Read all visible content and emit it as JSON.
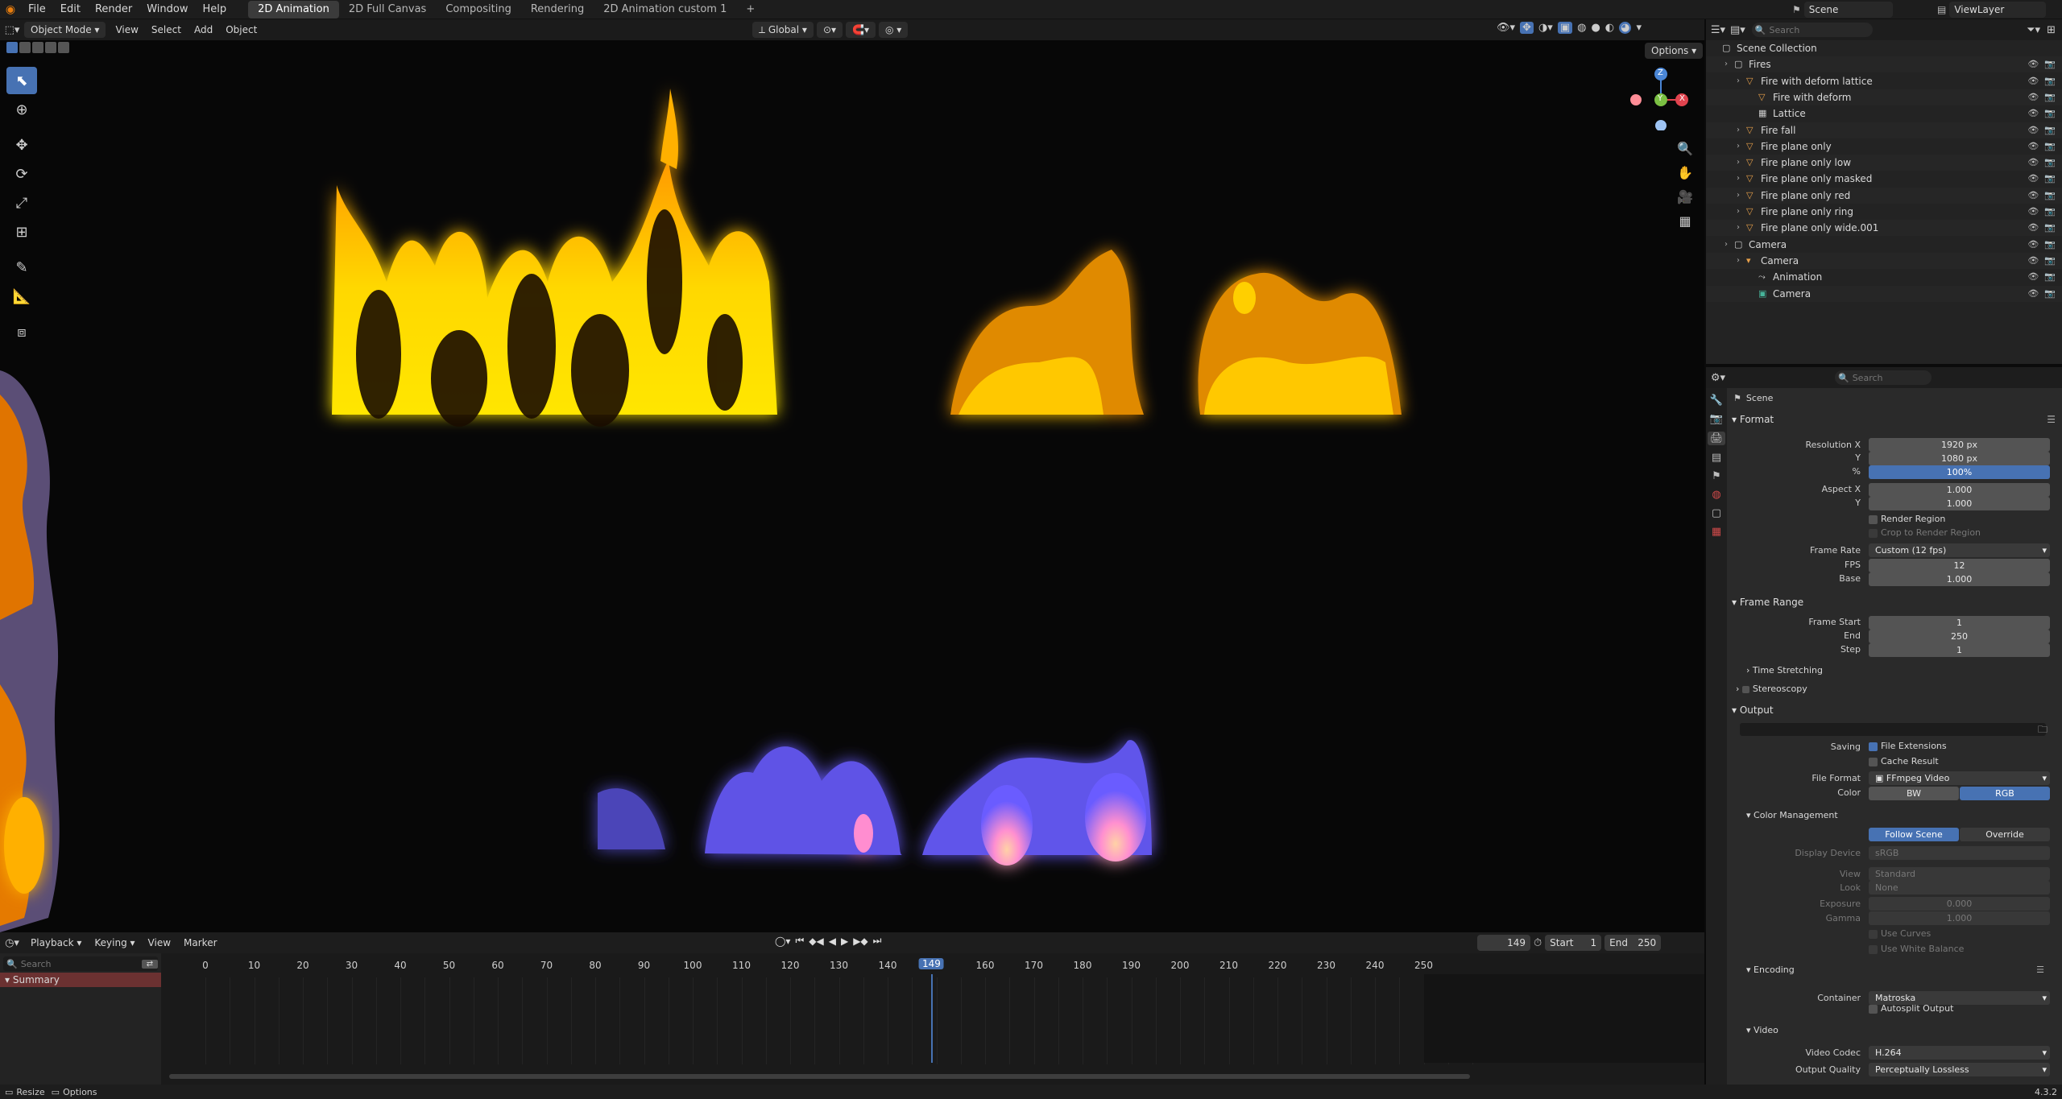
{
  "topbar": {
    "menus": [
      "File",
      "Edit",
      "Render",
      "Window",
      "Help"
    ],
    "workspaces": [
      "2D Animation",
      "2D Full Canvas",
      "Compositing",
      "Rendering",
      "2D Animation custom 1"
    ],
    "add_tab": "+",
    "scene": "Scene",
    "view_layer": "ViewLayer"
  },
  "viewport": {
    "mode": "Object Mode",
    "menus": [
      "View",
      "Select",
      "Add",
      "Object"
    ],
    "transform_orientation": "Global",
    "options": "Options",
    "gizmo": {
      "z": "Z",
      "y": "Y",
      "x": "X"
    }
  },
  "timeline": {
    "menus": [
      "Playback",
      "Keying",
      "View",
      "Marker"
    ],
    "current_frame": "149",
    "start_label": "Start",
    "start": "1",
    "end_label": "End",
    "end": "250",
    "search_placeholder": "Search",
    "summary": "Summary",
    "ticks": [
      "0",
      "10",
      "20",
      "30",
      "40",
      "50",
      "60",
      "70",
      "80",
      "90",
      "100",
      "110",
      "120",
      "130",
      "140",
      "149",
      "160",
      "170",
      "180",
      "190",
      "200",
      "210",
      "220",
      "230",
      "240",
      "250"
    ]
  },
  "statusbar": {
    "resize": "Resize",
    "options": "Options",
    "version": "4.3.2"
  },
  "outliner": {
    "search_placeholder": "Search",
    "rows": [
      {
        "label": "Scene Collection",
        "indent": 0
      },
      {
        "label": "Fires",
        "indent": 1
      },
      {
        "label": "Fire with deform lattice",
        "indent": 2
      },
      {
        "label": "Fire with deform",
        "indent": 3
      },
      {
        "label": "Lattice",
        "indent": 3
      },
      {
        "label": "Fire fall",
        "indent": 2
      },
      {
        "label": "Fire plane only",
        "indent": 2
      },
      {
        "label": "Fire plane only low",
        "indent": 2
      },
      {
        "label": "Fire plane only masked",
        "indent": 2
      },
      {
        "label": "Fire plane only red",
        "indent": 2
      },
      {
        "label": "Fire plane only ring",
        "indent": 2
      },
      {
        "label": "Fire plane only wide.001",
        "indent": 2
      },
      {
        "label": "Camera",
        "indent": 1
      },
      {
        "label": "Camera",
        "indent": 2
      },
      {
        "label": "Animation",
        "indent": 3
      },
      {
        "label": "Camera",
        "indent": 3
      }
    ]
  },
  "properties": {
    "search_placeholder": "Search",
    "context": "Scene",
    "format": {
      "title": "Format",
      "res_x_label": "Resolution X",
      "res_x": "1920 px",
      "res_y_label": "Y",
      "res_y": "1080 px",
      "res_pct_label": "%",
      "res_pct": "100%",
      "aspect_x_label": "Aspect X",
      "aspect_x": "1.000",
      "aspect_y_label": "Y",
      "aspect_y": "1.000",
      "render_region": "Render Region",
      "crop": "Crop to Render Region",
      "frame_rate_label": "Frame Rate",
      "frame_rate": "Custom (12 fps)",
      "fps_label": "FPS",
      "fps": "12",
      "base_label": "Base",
      "base": "1.000"
    },
    "frame_range": {
      "title": "Frame Range",
      "start_label": "Frame Start",
      "start": "1",
      "end_label": "End",
      "end": "250",
      "step_label": "Step",
      "step": "1",
      "time_stretching": "Time Stretching"
    },
    "stereoscopy": "Stereoscopy",
    "output": {
      "title": "Output",
      "saving_label": "Saving",
      "file_extensions": "File Extensions",
      "cache_result": "Cache Result",
      "file_format_label": "File Format",
      "file_format": "FFmpeg Video",
      "color_label": "Color",
      "bw": "BW",
      "rgb": "RGB"
    },
    "color_management": {
      "title": "Color Management",
      "follow_scene": "Follow Scene",
      "override": "Override",
      "display_device_label": "Display Device",
      "display_device": "sRGB",
      "view_label": "View",
      "view": "Standard",
      "look_label": "Look",
      "look": "None",
      "exposure_label": "Exposure",
      "exposure": "0.000",
      "gamma_label": "Gamma",
      "gamma": "1.000",
      "use_curves": "Use Curves",
      "use_white_balance": "Use White Balance"
    },
    "encoding": {
      "title": "Encoding",
      "container_label": "Container",
      "container": "Matroska",
      "autosplit": "Autosplit Output"
    },
    "video": {
      "title": "Video",
      "codec_label": "Video Codec",
      "codec": "H.264",
      "quality_label": "Output Quality",
      "quality": "Perceptually Lossless"
    }
  },
  "colors": {
    "accent": "#4772b3",
    "fire_orange": "#ff8a00",
    "fire_yellow": "#ffd400",
    "fire_purple": "#6a5cff"
  }
}
